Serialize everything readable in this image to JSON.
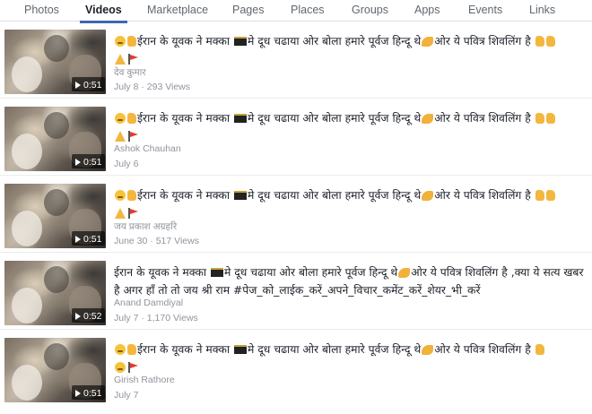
{
  "tabs": [
    {
      "label": "Photos",
      "active": false
    },
    {
      "label": "Videos",
      "active": true
    },
    {
      "label": "Marketplace",
      "active": false
    },
    {
      "label": "Pages",
      "active": false
    },
    {
      "label": "Places",
      "active": false
    },
    {
      "label": "Groups",
      "active": false
    },
    {
      "label": "Apps",
      "active": false
    },
    {
      "label": "Events",
      "active": false
    },
    {
      "label": "Links",
      "active": false
    }
  ],
  "videos": [
    {
      "duration": "0:51",
      "title_a": "ईरान के यूवक ने मक्का",
      "title_b": "मे दूध चढाया ओर बोला हमारे पूर्वज हिन्दू थे",
      "title_c": "ओर ये पवित्र शिवलिंग है",
      "author": "देव कुमार",
      "meta": "July 8 · 293 Views"
    },
    {
      "duration": "0:51",
      "title_a": "ईरान के यूवक ने मक्का",
      "title_b": "मे दूध चढाया ओर बोला हमारे पूर्वज हिन्दू थे",
      "title_c": "ओर ये पवित्र शिवलिंग है",
      "author": "Ashok Chauhan",
      "meta": "July 6"
    },
    {
      "duration": "0:51",
      "title_a": "ईरान के यूवक ने मक्का",
      "title_b": "मे दूध चढाया ओर बोला हमारे पूर्वज हिन्दू थे",
      "title_c": "ओर ये पवित्र शिवलिंग है",
      "author": "जय प्रकाश अग्रहरि",
      "meta": "June 30 · 517 Views"
    },
    {
      "duration": "0:52",
      "title_a": "ईरान के यूवक ने मक्का",
      "title_b": "मे दूध चढाया ओर बोला हमारे पूर्वज हिन्दू थे",
      "title_c": "ओर ये पवित्र शिवलिंग है ,क्या ये सत्य खबर है अगर हाँ तो तो जय श्री राम #पेज_को_लाईक_करें_अपने_विचार_कमेंट_करें_शेयर_भी_करें",
      "author": "Anand Damdiyal",
      "meta": "July 7 · 1,170 Views"
    },
    {
      "duration": "0:51",
      "title_a": "ईरान के यूवक ने मक्का",
      "title_b": "मे दूध चढाया ओर बोला हमारे पूर्वज हिन्दू थे",
      "title_c": "ओर ये पवित्र शिवलिंग है",
      "author": "Girish Rathore",
      "meta": "July 7"
    }
  ],
  "colors": {
    "accent": "#4267b2",
    "muted_text": "#90949c",
    "body_text": "#1d2129"
  },
  "icons": [
    "play-icon",
    "emoji-thinking-face",
    "emoji-ok-hand",
    "emoji-kaaba",
    "emoji-flexed-biceps",
    "emoji-pointing-hand",
    "emoji-folded-hands",
    "emoji-triangular-flag"
  ]
}
